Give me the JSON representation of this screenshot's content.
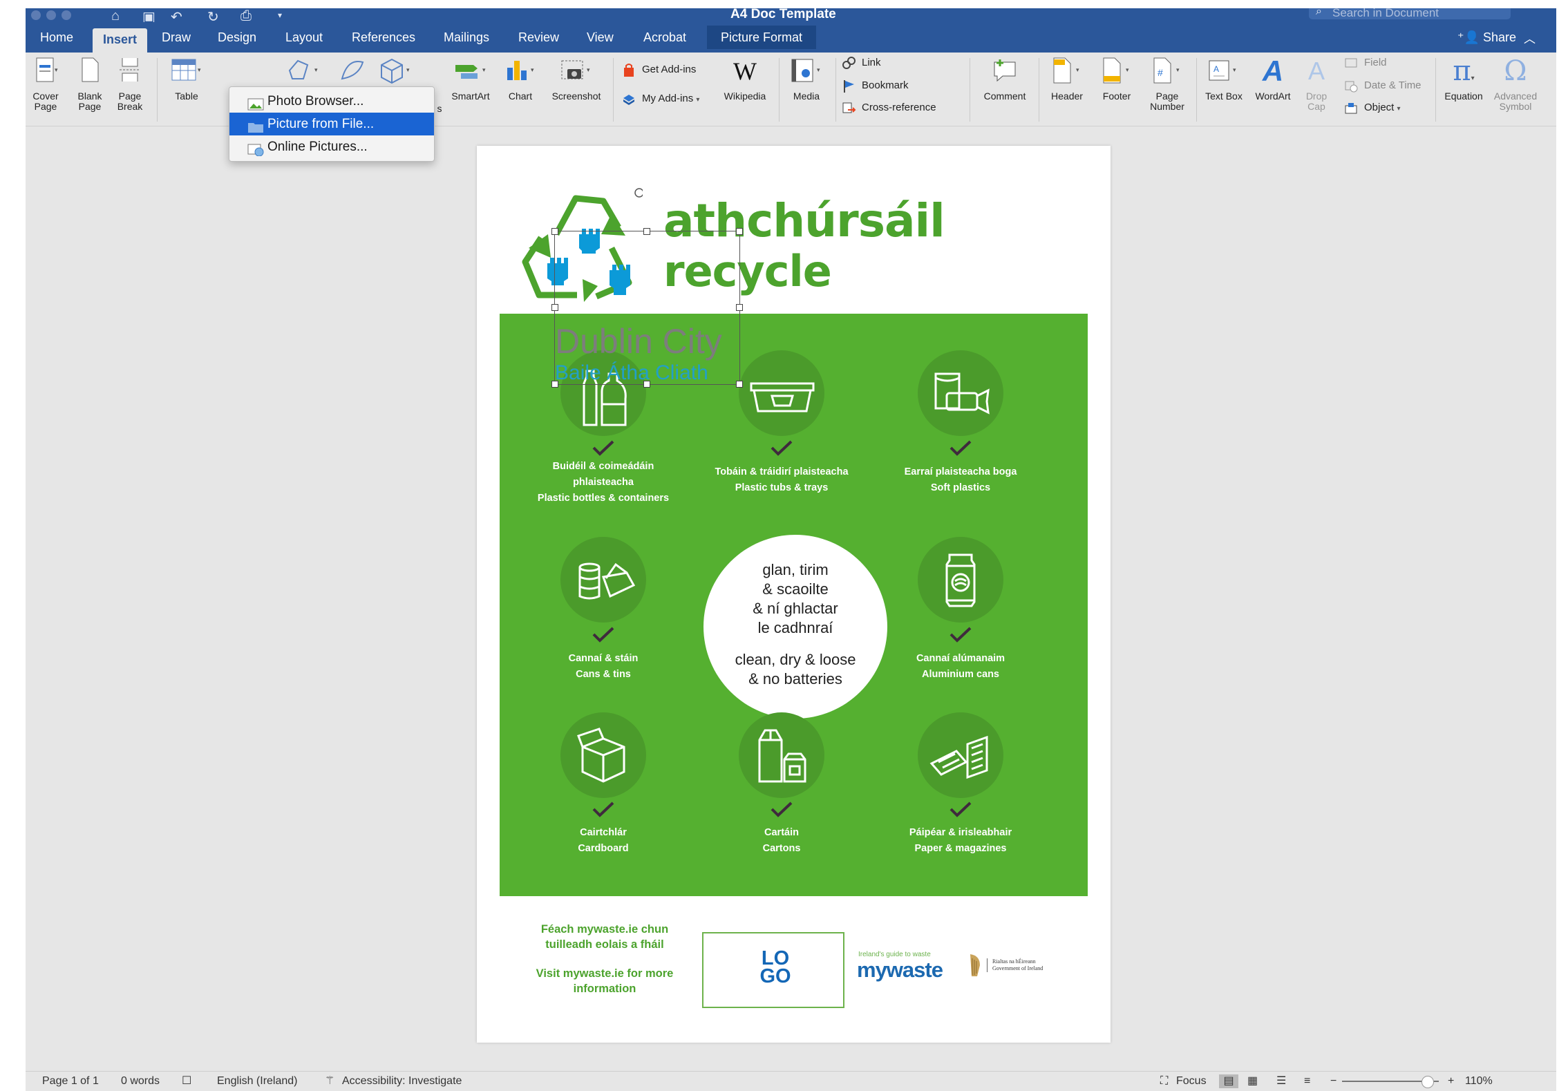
{
  "window": {
    "title": "A4 Doc Template",
    "search_placeholder": "Search in Document"
  },
  "tabs": [
    "Home",
    "Insert",
    "Draw",
    "Design",
    "Layout",
    "References",
    "Mailings",
    "Review",
    "View",
    "Acrobat",
    "Picture Format"
  ],
  "active_tab": "Insert",
  "share_label": "Share",
  "ribbon": {
    "cover_page": "Cover\nPage",
    "blank_page": "Blank\nPage",
    "page_break": "Page\nBreak",
    "table": "Table",
    "smartart": "SmartArt",
    "chart": "Chart",
    "screenshot": "Screenshot",
    "get_addins": "Get Add-ins",
    "my_addins": "My Add-ins",
    "wikipedia": "Wikipedia",
    "media": "Media",
    "link": "Link",
    "bookmark": "Bookmark",
    "cross_reference": "Cross-reference",
    "comment": "Comment",
    "header": "Header",
    "footer": "Footer",
    "page_number": "Page\nNumber",
    "text_box": "Text Box",
    "wordart": "WordArt",
    "drop_cap": "Drop\nCap",
    "field": "Field",
    "date_time": "Date & Time",
    "object": "Object",
    "equation": "Equation",
    "advanced_symbol": "Advanced\nSymbol",
    "partial_label": "s"
  },
  "picture_menu": {
    "items": [
      "Photo Browser...",
      "Picture from File...",
      "Online Pictures..."
    ],
    "highlighted": "Picture from File..."
  },
  "document": {
    "title_ga": "athchúrsáil",
    "title_en": "recycle",
    "textbox_line1": "Dublin City",
    "textbox_line2": "Baile Átha Cliath",
    "categories": [
      {
        "ga": "Buidéil & coimeádáin phlaisteacha",
        "en": "Plastic bottles & containers",
        "icon": "bottles-icon"
      },
      {
        "ga": "Tobáin & tráidirí plaisteacha",
        "en": "Plastic tubs & trays",
        "icon": "tub-icon"
      },
      {
        "ga": "Earraí plaisteacha boga",
        "en": "Soft plastics",
        "icon": "soft-plastics-icon"
      },
      {
        "ga": "Cannaí & stáin",
        "en": "Cans & tins",
        "icon": "cans-icon"
      },
      {
        "ga": "Cannaí alúmanaim",
        "en": "Aluminium cans",
        "icon": "aluminium-can-icon"
      },
      {
        "ga": "Cairtchlár",
        "en": "Cardboard",
        "icon": "cardboard-box-icon"
      },
      {
        "ga": "Cartáin",
        "en": "Cartons",
        "icon": "cartons-icon"
      },
      {
        "ga": "Páipéar & irisleabhair",
        "en": "Paper & magazines",
        "icon": "paper-icon"
      }
    ],
    "center_ga": "glan, tirim\n& scaoilte\n& ní ghlactar\nle cadhnraí",
    "center_en": "clean, dry & loose\n& no batteries",
    "footer_ga": "Féach mywaste.ie chun tuilleadh eolais a fháil",
    "footer_en": "Visit mywaste.ie for more information",
    "logo_placeholder": "LO\nGO",
    "mywaste_tagline": "Ireland's guide to waste",
    "mywaste_name": "mywaste",
    "gov_ga": "Rialtas na hÉireann",
    "gov_en": "Government of Ireland"
  },
  "status_bar": {
    "page": "Page 1 of 1",
    "words": "0 words",
    "language": "English (Ireland)",
    "accessibility": "Accessibility: Investigate",
    "focus": "Focus",
    "zoom": "110%"
  },
  "colors": {
    "ribbon_blue": "#2b579a",
    "green": "#55b030",
    "highlight": "#1a64d3"
  }
}
